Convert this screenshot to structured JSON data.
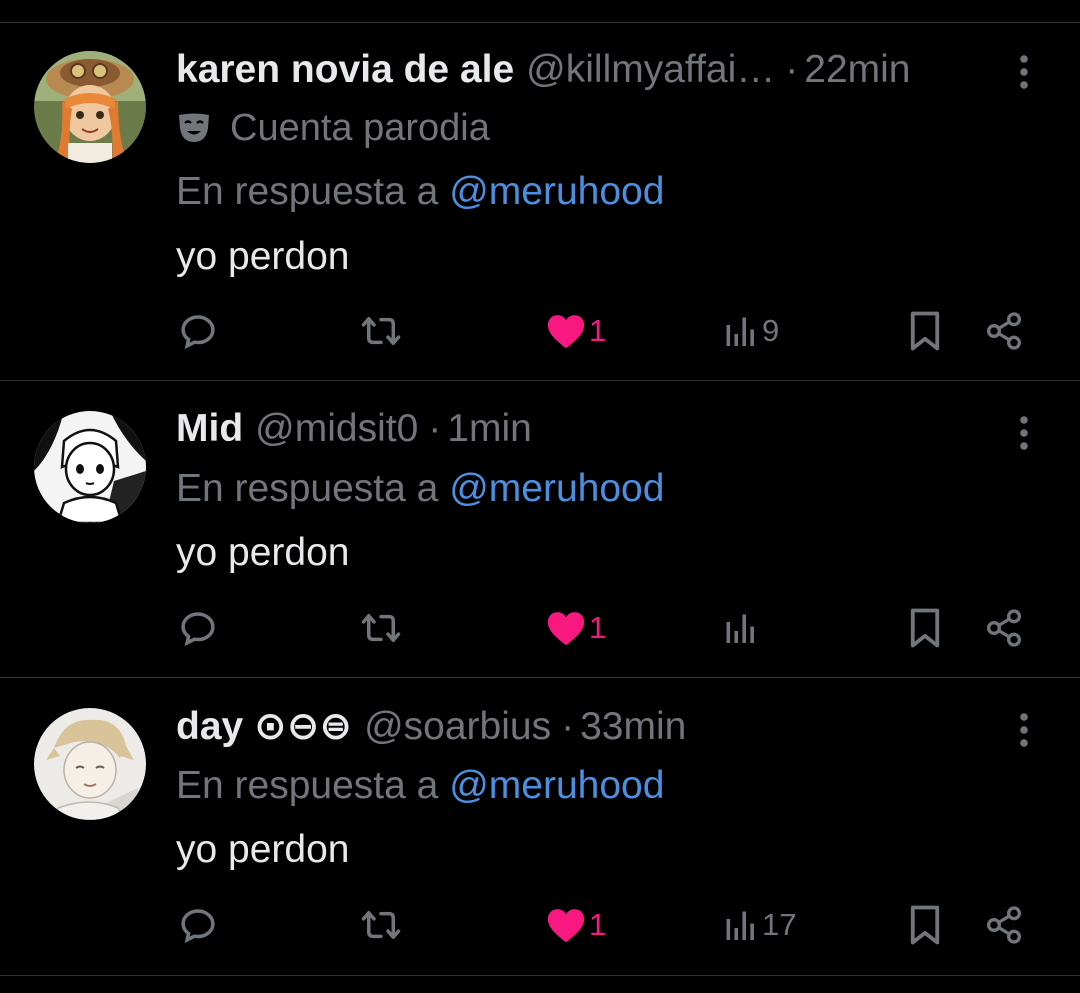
{
  "colors": {
    "background": "#000000",
    "divider": "#2f3336",
    "primary_text": "#e7e9ea",
    "secondary_text": "#71767b",
    "mention": "#4a8fe0",
    "like": "#f91880"
  },
  "tweets": [
    {
      "display_name": "karen novia de ale",
      "handle": "@killmyaffai…",
      "separator": "·",
      "time": "22min",
      "badge_label": "Cuenta parodia",
      "reply_prefix": "En respuesta a",
      "reply_mention": "@meruhood",
      "text": "yo perdon",
      "stats": {
        "replies": "",
        "retweets": "",
        "likes": "1",
        "views": "9"
      }
    },
    {
      "display_name": "Mid",
      "handle": "@midsit0",
      "separator": "·",
      "time": "1min",
      "reply_prefix": "En respuesta a",
      "reply_mention": "@meruhood",
      "text": "yo perdon",
      "stats": {
        "replies": "",
        "retweets": "",
        "likes": "1",
        "views": ""
      }
    },
    {
      "display_name": "day ⊙⊖⊜",
      "handle": "@soarbius",
      "separator": "·",
      "time": "33min",
      "reply_prefix": "En respuesta a",
      "reply_mention": "@meruhood",
      "text": "yo perdon",
      "stats": {
        "replies": "",
        "retweets": "",
        "likes": "1",
        "views": "17"
      }
    }
  ],
  "icons": {
    "more": "more-vertical-icon",
    "reply": "reply-bubble-icon",
    "retweet": "retweet-icon",
    "like": "heart-filled-icon",
    "views": "views-chart-icon",
    "bookmark": "bookmark-icon",
    "share": "share-icon",
    "parody": "theater-mask-icon"
  }
}
